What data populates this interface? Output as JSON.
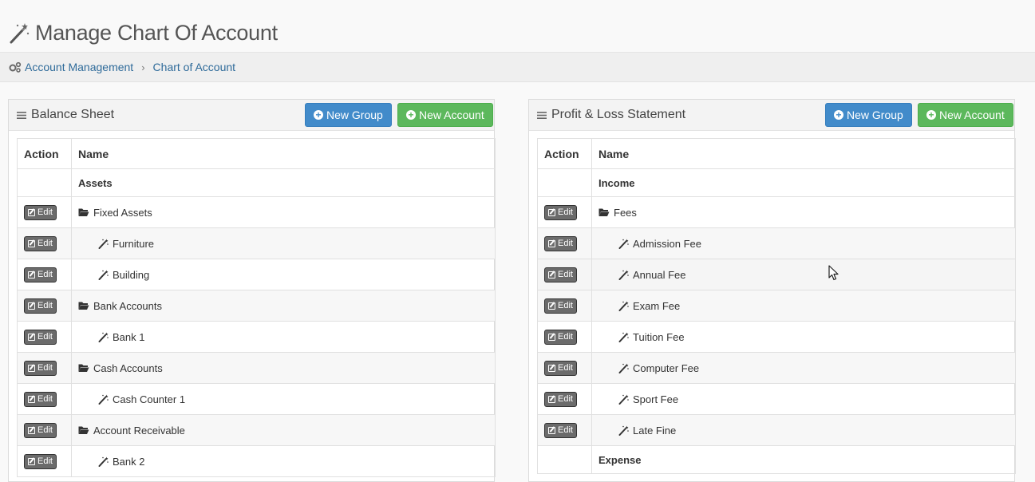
{
  "page": {
    "title": "Manage Chart Of Account"
  },
  "breadcrumb": {
    "items": [
      "Account Management",
      "Chart of Account"
    ]
  },
  "panels": [
    {
      "title": "Balance Sheet",
      "new_group_label": "New Group",
      "new_account_label": "New Account",
      "columns": [
        "Action",
        "Name"
      ],
      "rows": [
        {
          "type": "header",
          "name": "Assets"
        },
        {
          "type": "group",
          "name": "Fixed Assets",
          "edit_label": "Edit"
        },
        {
          "type": "account",
          "name": "Furniture",
          "edit_label": "Edit"
        },
        {
          "type": "account",
          "name": "Building",
          "edit_label": "Edit"
        },
        {
          "type": "group",
          "name": "Bank Accounts",
          "edit_label": "Edit"
        },
        {
          "type": "account",
          "name": "Bank 1",
          "edit_label": "Edit"
        },
        {
          "type": "group",
          "name": "Cash Accounts",
          "edit_label": "Edit"
        },
        {
          "type": "account",
          "name": "Cash Counter 1",
          "edit_label": "Edit"
        },
        {
          "type": "group",
          "name": "Account Receivable",
          "edit_label": "Edit"
        },
        {
          "type": "account",
          "name": "Bank 2",
          "edit_label": "Edit"
        }
      ]
    },
    {
      "title": "Profit & Loss Statement",
      "new_group_label": "New Group",
      "new_account_label": "New Account",
      "columns": [
        "Action",
        "Name"
      ],
      "rows": [
        {
          "type": "header",
          "name": "Income"
        },
        {
          "type": "group",
          "name": "Fees",
          "edit_label": "Edit"
        },
        {
          "type": "account",
          "name": "Admission Fee",
          "edit_label": "Edit"
        },
        {
          "type": "account",
          "name": "Annual Fee",
          "edit_label": "Edit",
          "hover": true
        },
        {
          "type": "account",
          "name": "Exam Fee",
          "edit_label": "Edit"
        },
        {
          "type": "account",
          "name": "Tuition Fee",
          "edit_label": "Edit"
        },
        {
          "type": "account",
          "name": "Computer Fee",
          "edit_label": "Edit"
        },
        {
          "type": "account",
          "name": "Sport Fee",
          "edit_label": "Edit"
        },
        {
          "type": "account",
          "name": "Late Fine",
          "edit_label": "Edit"
        },
        {
          "type": "header",
          "name": "Expense"
        }
      ]
    }
  ],
  "icons": {
    "title": "magic-wand-icon",
    "breadcrumb": "gears-icon",
    "panel": "list-icon",
    "group": "folder-open-icon",
    "account": "magic-wand-icon",
    "button": "plus-circle-icon",
    "edit": "edit-icon"
  },
  "colors": {
    "primary": "#428bca",
    "success": "#5cb85c",
    "edit": "#6b6b6b",
    "link": "#2f6b9a"
  }
}
